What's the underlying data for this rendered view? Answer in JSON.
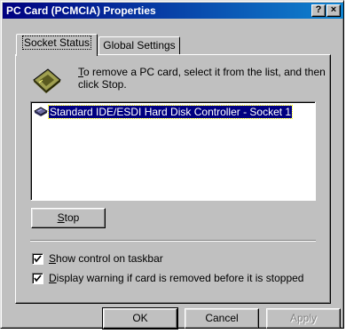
{
  "window": {
    "title": "PC Card (PCMCIA) Properties",
    "help_glyph": "?",
    "close_glyph": "×"
  },
  "tabs": [
    {
      "label": "Socket Status",
      "active": true
    },
    {
      "label": "Global Settings",
      "active": false
    }
  ],
  "socket_status": {
    "icon": "pc-card-icon",
    "instructions_mnemonic": "T",
    "instructions_rest": "o remove a PC card, select it from the list, and then click Stop.",
    "list_items": [
      {
        "icon": "disk-controller-icon",
        "label": "Standard IDE/ESDI Hard Disk Controller - Socket 1",
        "selected": true
      }
    ],
    "stop_button": {
      "mnemonic": "S",
      "rest": "top"
    },
    "checkboxes": [
      {
        "pre": "",
        "mnemonic": "S",
        "rest": "how control on taskbar",
        "checked": true
      },
      {
        "pre": "",
        "mnemonic": "D",
        "rest": "isplay warning if card is removed before it is stopped",
        "checked": true
      }
    ]
  },
  "footer": {
    "ok_label": "OK",
    "cancel_label": "Cancel",
    "apply_label": "Apply",
    "apply_enabled": false
  },
  "colors": {
    "face": "#c0c0c0",
    "title_start": "#000080",
    "title_end": "#1084d0",
    "selection": "#000080"
  }
}
